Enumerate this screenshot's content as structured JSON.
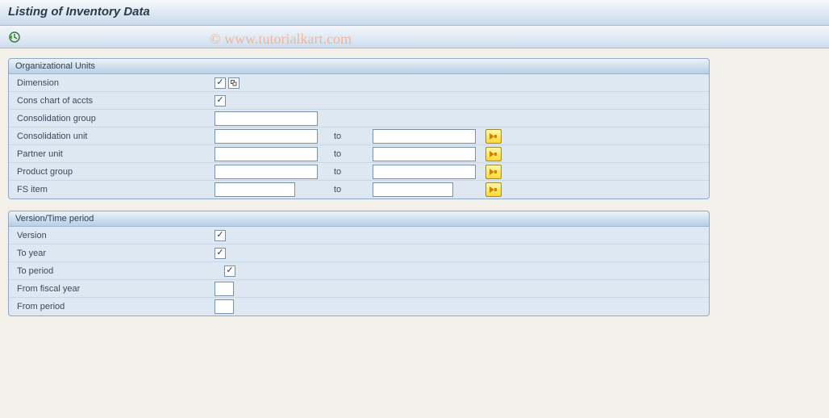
{
  "title": "Listing of Inventory Data",
  "watermark": "© www.tutorialkart.com",
  "group1": {
    "header": "Organizational Units",
    "dimension": {
      "label": "Dimension",
      "checked": true
    },
    "cons_chart": {
      "label": "Cons chart of accts",
      "checked": true
    },
    "cons_group": {
      "label": "Consolidation group",
      "value": ""
    },
    "cons_unit": {
      "label": "Consolidation unit",
      "from": "",
      "to_label": "to",
      "to": ""
    },
    "partner_unit": {
      "label": "Partner unit",
      "from": "",
      "to_label": "to",
      "to": ""
    },
    "product_group": {
      "label": "Product group",
      "from": "",
      "to_label": "to",
      "to": ""
    },
    "fs_item": {
      "label": "FS item",
      "from": "",
      "to_label": "to",
      "to": ""
    }
  },
  "group2": {
    "header": "Version/Time period",
    "version": {
      "label": "Version",
      "checked": true
    },
    "to_year": {
      "label": "To year",
      "checked": true
    },
    "to_period": {
      "label": "To period",
      "checked": true
    },
    "from_fy": {
      "label": "From fiscal year",
      "value": ""
    },
    "from_period": {
      "label": "From period",
      "value": ""
    }
  }
}
